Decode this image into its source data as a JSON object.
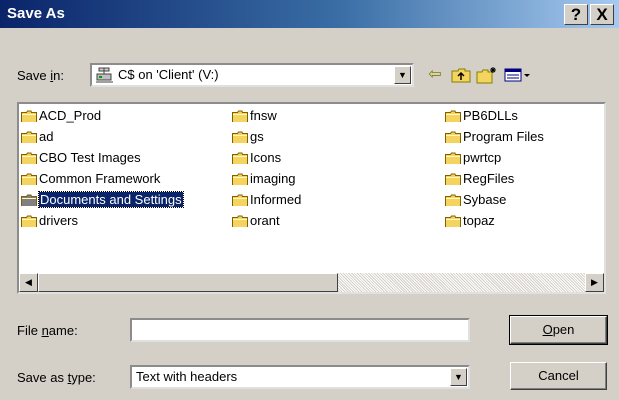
{
  "window": {
    "title": "Save As",
    "help_button": "?",
    "close_button": "X"
  },
  "save_in": {
    "label_pre": "Save ",
    "label_key": "i",
    "label_post": "n:",
    "value": "C$ on 'Client' (V:)",
    "icon": "network-drive-icon"
  },
  "toolbar": [
    {
      "name": "back-icon",
      "glyph": "⇦",
      "color": "#808000"
    },
    {
      "name": "up-one-level-icon",
      "glyph": "⬑",
      "color": "#808000"
    },
    {
      "name": "new-folder-icon",
      "glyph": "✲",
      "color": "#808000"
    },
    {
      "name": "view-menu-icon",
      "glyph": "▦▾",
      "color": "#000080"
    }
  ],
  "folders": [
    {
      "col": 0,
      "row": 0,
      "name": "ACD_Prod"
    },
    {
      "col": 0,
      "row": 1,
      "name": "ad"
    },
    {
      "col": 0,
      "row": 2,
      "name": "CBO Test Images"
    },
    {
      "col": 0,
      "row": 3,
      "name": "Common Framework"
    },
    {
      "col": 0,
      "row": 4,
      "name": "Documents and Settings",
      "selected": true
    },
    {
      "col": 0,
      "row": 5,
      "name": "drivers"
    },
    {
      "col": 1,
      "row": 0,
      "name": "fnsw"
    },
    {
      "col": 1,
      "row": 1,
      "name": "gs"
    },
    {
      "col": 1,
      "row": 2,
      "name": "Icons"
    },
    {
      "col": 1,
      "row": 3,
      "name": "imaging"
    },
    {
      "col": 1,
      "row": 4,
      "name": "Informed"
    },
    {
      "col": 1,
      "row": 5,
      "name": "orant"
    },
    {
      "col": 2,
      "row": 0,
      "name": "PB6DLLs"
    },
    {
      "col": 2,
      "row": 1,
      "name": "Program Files"
    },
    {
      "col": 2,
      "row": 2,
      "name": "pwrtcp"
    },
    {
      "col": 2,
      "row": 3,
      "name": "RegFiles"
    },
    {
      "col": 2,
      "row": 4,
      "name": "Sybase"
    },
    {
      "col": 2,
      "row": 5,
      "name": "topaz"
    }
  ],
  "folder_icon": "folder-icon",
  "file_name": {
    "label_pre": "File ",
    "label_key": "n",
    "label_post": "ame:",
    "value": ""
  },
  "save_type": {
    "label_pre": "Save as ",
    "label_key": "t",
    "label_post": "ype:",
    "value": "Text with headers"
  },
  "buttons": {
    "open_key": "O",
    "open_rest": "pen",
    "cancel": "Cancel"
  },
  "colors": {
    "title_bar": "#0a246a",
    "selection": "#0a246a",
    "folder_yellow": "#f4d35e"
  }
}
